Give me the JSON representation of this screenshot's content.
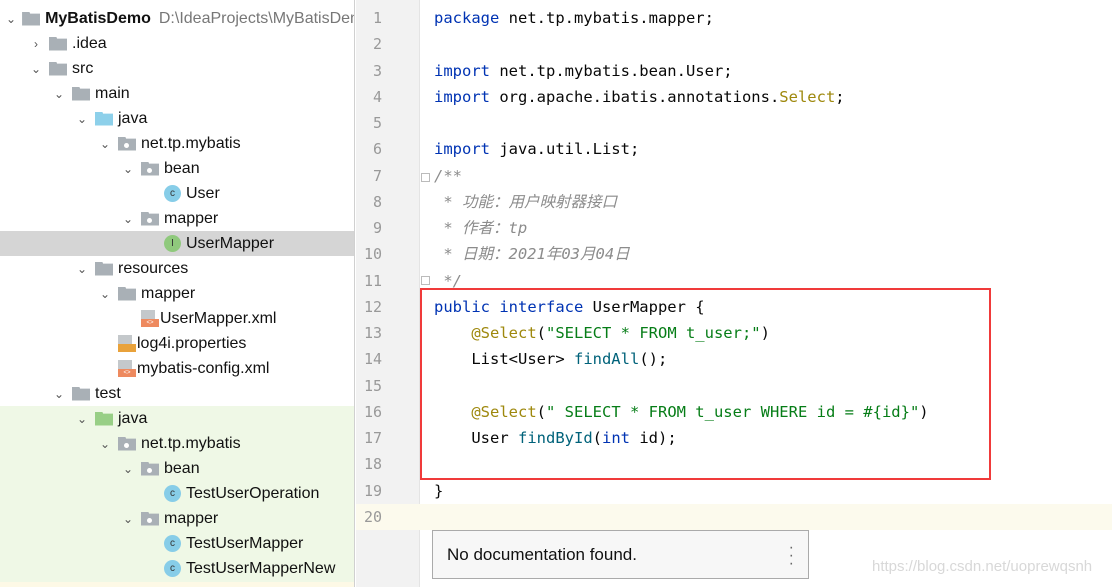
{
  "tree": [
    {
      "label": "MyBatisDemo",
      "path": "D:\\IdeaProjects\\MyBatisDemo",
      "depth": 0,
      "arrow": "down",
      "icon": "module-folder-icon"
    },
    {
      "label": ".idea",
      "depth": 1,
      "arrow": "right",
      "icon": "folder-icon"
    },
    {
      "label": "src",
      "depth": 1,
      "arrow": "down",
      "icon": "folder-icon"
    },
    {
      "label": "main",
      "depth": 2,
      "arrow": "down",
      "icon": "folder-icon"
    },
    {
      "label": "java",
      "depth": 3,
      "arrow": "down",
      "icon": "source-folder-icon"
    },
    {
      "label": "net.tp.mybatis",
      "depth": 4,
      "arrow": "down",
      "icon": "package-icon"
    },
    {
      "label": "bean",
      "depth": 5,
      "arrow": "down",
      "icon": "package-icon"
    },
    {
      "label": "User",
      "depth": 6,
      "arrow": "",
      "icon": "class-icon"
    },
    {
      "label": "mapper",
      "depth": 5,
      "arrow": "down",
      "icon": "package-icon"
    },
    {
      "label": "UserMapper",
      "depth": 6,
      "arrow": "",
      "icon": "interface-icon",
      "selected": true
    },
    {
      "label": "resources",
      "depth": 3,
      "arrow": "down",
      "icon": "resources-folder-icon"
    },
    {
      "label": "mapper",
      "depth": 4,
      "arrow": "down",
      "icon": "folder-icon"
    },
    {
      "label": "UserMapper.xml",
      "depth": 5,
      "arrow": "",
      "icon": "xml-file-icon"
    },
    {
      "label": "log4i.properties",
      "depth": 4,
      "arrow": "",
      "icon": "properties-file-icon"
    },
    {
      "label": "mybatis-config.xml",
      "depth": 4,
      "arrow": "",
      "icon": "xml-file-icon"
    },
    {
      "label": "test",
      "depth": 2,
      "arrow": "down",
      "icon": "folder-icon"
    },
    {
      "label": "java",
      "depth": 3,
      "arrow": "down",
      "icon": "test-folder-icon"
    },
    {
      "label": "net.tp.mybatis",
      "depth": 4,
      "arrow": "down",
      "icon": "package-icon"
    },
    {
      "label": "bean",
      "depth": 5,
      "arrow": "down",
      "icon": "package-icon"
    },
    {
      "label": "TestUserOperation",
      "depth": 6,
      "arrow": "",
      "icon": "test-class-icon"
    },
    {
      "label": "mapper",
      "depth": 5,
      "arrow": "down",
      "icon": "package-icon"
    },
    {
      "label": "TestUserMapper",
      "depth": 6,
      "arrow": "",
      "icon": "test-class-icon"
    },
    {
      "label": "TestUserMapperNew",
      "depth": 6,
      "arrow": "",
      "icon": "test-class-icon"
    }
  ],
  "code": [
    [
      [
        "package ",
        "kw"
      ],
      [
        "net.tp.mybatis.mapper;",
        ""
      ]
    ],
    [],
    [
      [
        "import ",
        "kw"
      ],
      [
        "net.tp.mybatis.bean.User;",
        ""
      ]
    ],
    [
      [
        "import ",
        "kw"
      ],
      [
        "org.apache.ibatis.annotations.",
        ""
      ],
      [
        "Select",
        "ann"
      ],
      [
        ";",
        ""
      ]
    ],
    [],
    [
      [
        "import ",
        "kw"
      ],
      [
        "java.util.List;",
        ""
      ]
    ],
    [
      [
        "/**",
        "cm"
      ]
    ],
    [
      [
        " * 功能：用户映射器接口",
        "cm"
      ]
    ],
    [
      [
        " * 作者：tp",
        "cm"
      ]
    ],
    [
      [
        " * 日期：2021年03月04日",
        "cm"
      ]
    ],
    [
      [
        " */",
        "cm"
      ]
    ],
    [
      [
        "public interface ",
        "kw"
      ],
      [
        "UserMapper {",
        ""
      ]
    ],
    [
      [
        "    @Select",
        "ann"
      ],
      [
        "(",
        ""
      ],
      [
        "\"SELECT * FROM t_user;\"",
        "str"
      ],
      [
        ")",
        ""
      ]
    ],
    [
      [
        "    List<User> ",
        ""
      ],
      [
        "findAll",
        "fn"
      ],
      [
        "();",
        ""
      ]
    ],
    [],
    [
      [
        "    @Select",
        "ann"
      ],
      [
        "(",
        ""
      ],
      [
        "\" SELECT * FROM t_user WHERE id = #{id}\"",
        "str"
      ],
      [
        ")",
        ""
      ]
    ],
    [
      [
        "    User ",
        ""
      ],
      [
        "findById",
        "fn"
      ],
      [
        "(",
        ""
      ],
      [
        "int ",
        "kw"
      ],
      [
        "id);",
        ""
      ]
    ],
    [],
    [
      [
        "}",
        ""
      ]
    ],
    []
  ],
  "popup": {
    "text": "No documentation found.",
    "menu_icon": "more-vertical-icon"
  },
  "watermark": "https://blog.csdn.net/uoprewqsnh",
  "colors": {
    "highlight_box": "#f03a3a",
    "keyword": "#0033b3",
    "string": "#067d17",
    "annotation": "#9e880d"
  }
}
